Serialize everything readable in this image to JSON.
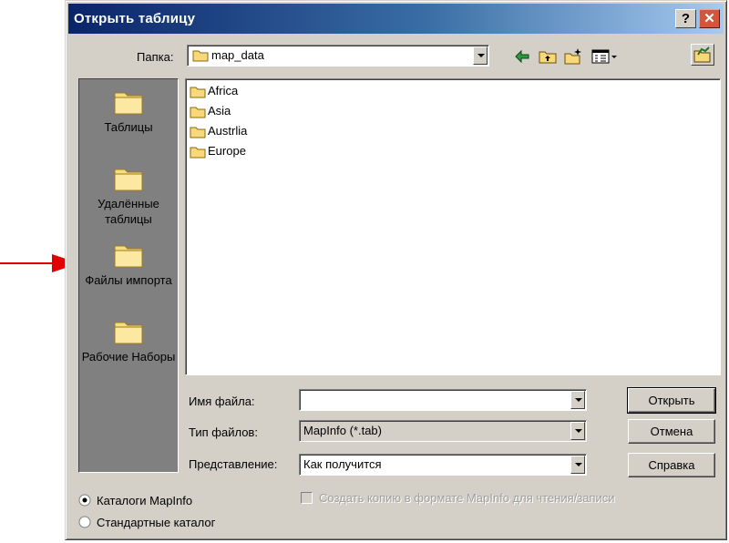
{
  "window": {
    "title": "Открыть таблицу",
    "help_button": "?",
    "close_button": "✕"
  },
  "folder": {
    "label": "Папка:",
    "value": "map_data",
    "icons": [
      "back-icon",
      "up-folder-icon",
      "new-folder-icon",
      "view-menu-icon",
      "find-folder-icon"
    ]
  },
  "places": [
    {
      "label": "Таблицы"
    },
    {
      "label": "Удалённые таблицы"
    },
    {
      "label": "Файлы импорта"
    },
    {
      "label": "Рабочие Наборы"
    }
  ],
  "files": [
    "Africa",
    "Asia",
    "Austrlia",
    "Europe"
  ],
  "fields": {
    "filename_label": "Имя файла:",
    "filename_value": "",
    "filetype_label": "Тип файлов:",
    "filetype_value": "MapInfo (*.tab)",
    "view_label": "Представление:",
    "view_value": "Как получится"
  },
  "buttons": {
    "open": "Открыть",
    "cancel": "Отмена",
    "help": "Справка"
  },
  "options": {
    "radio_mapinfo": "Каталоги MapInfo",
    "radio_standard": "Стандартные каталог",
    "radio_selected": "mapinfo",
    "copy_checkbox": "Создать копию в формате MapInfo для чтения/записи",
    "copy_checked": false,
    "copy_enabled": false
  },
  "annotation": {
    "arrow_color": "#e00000"
  }
}
